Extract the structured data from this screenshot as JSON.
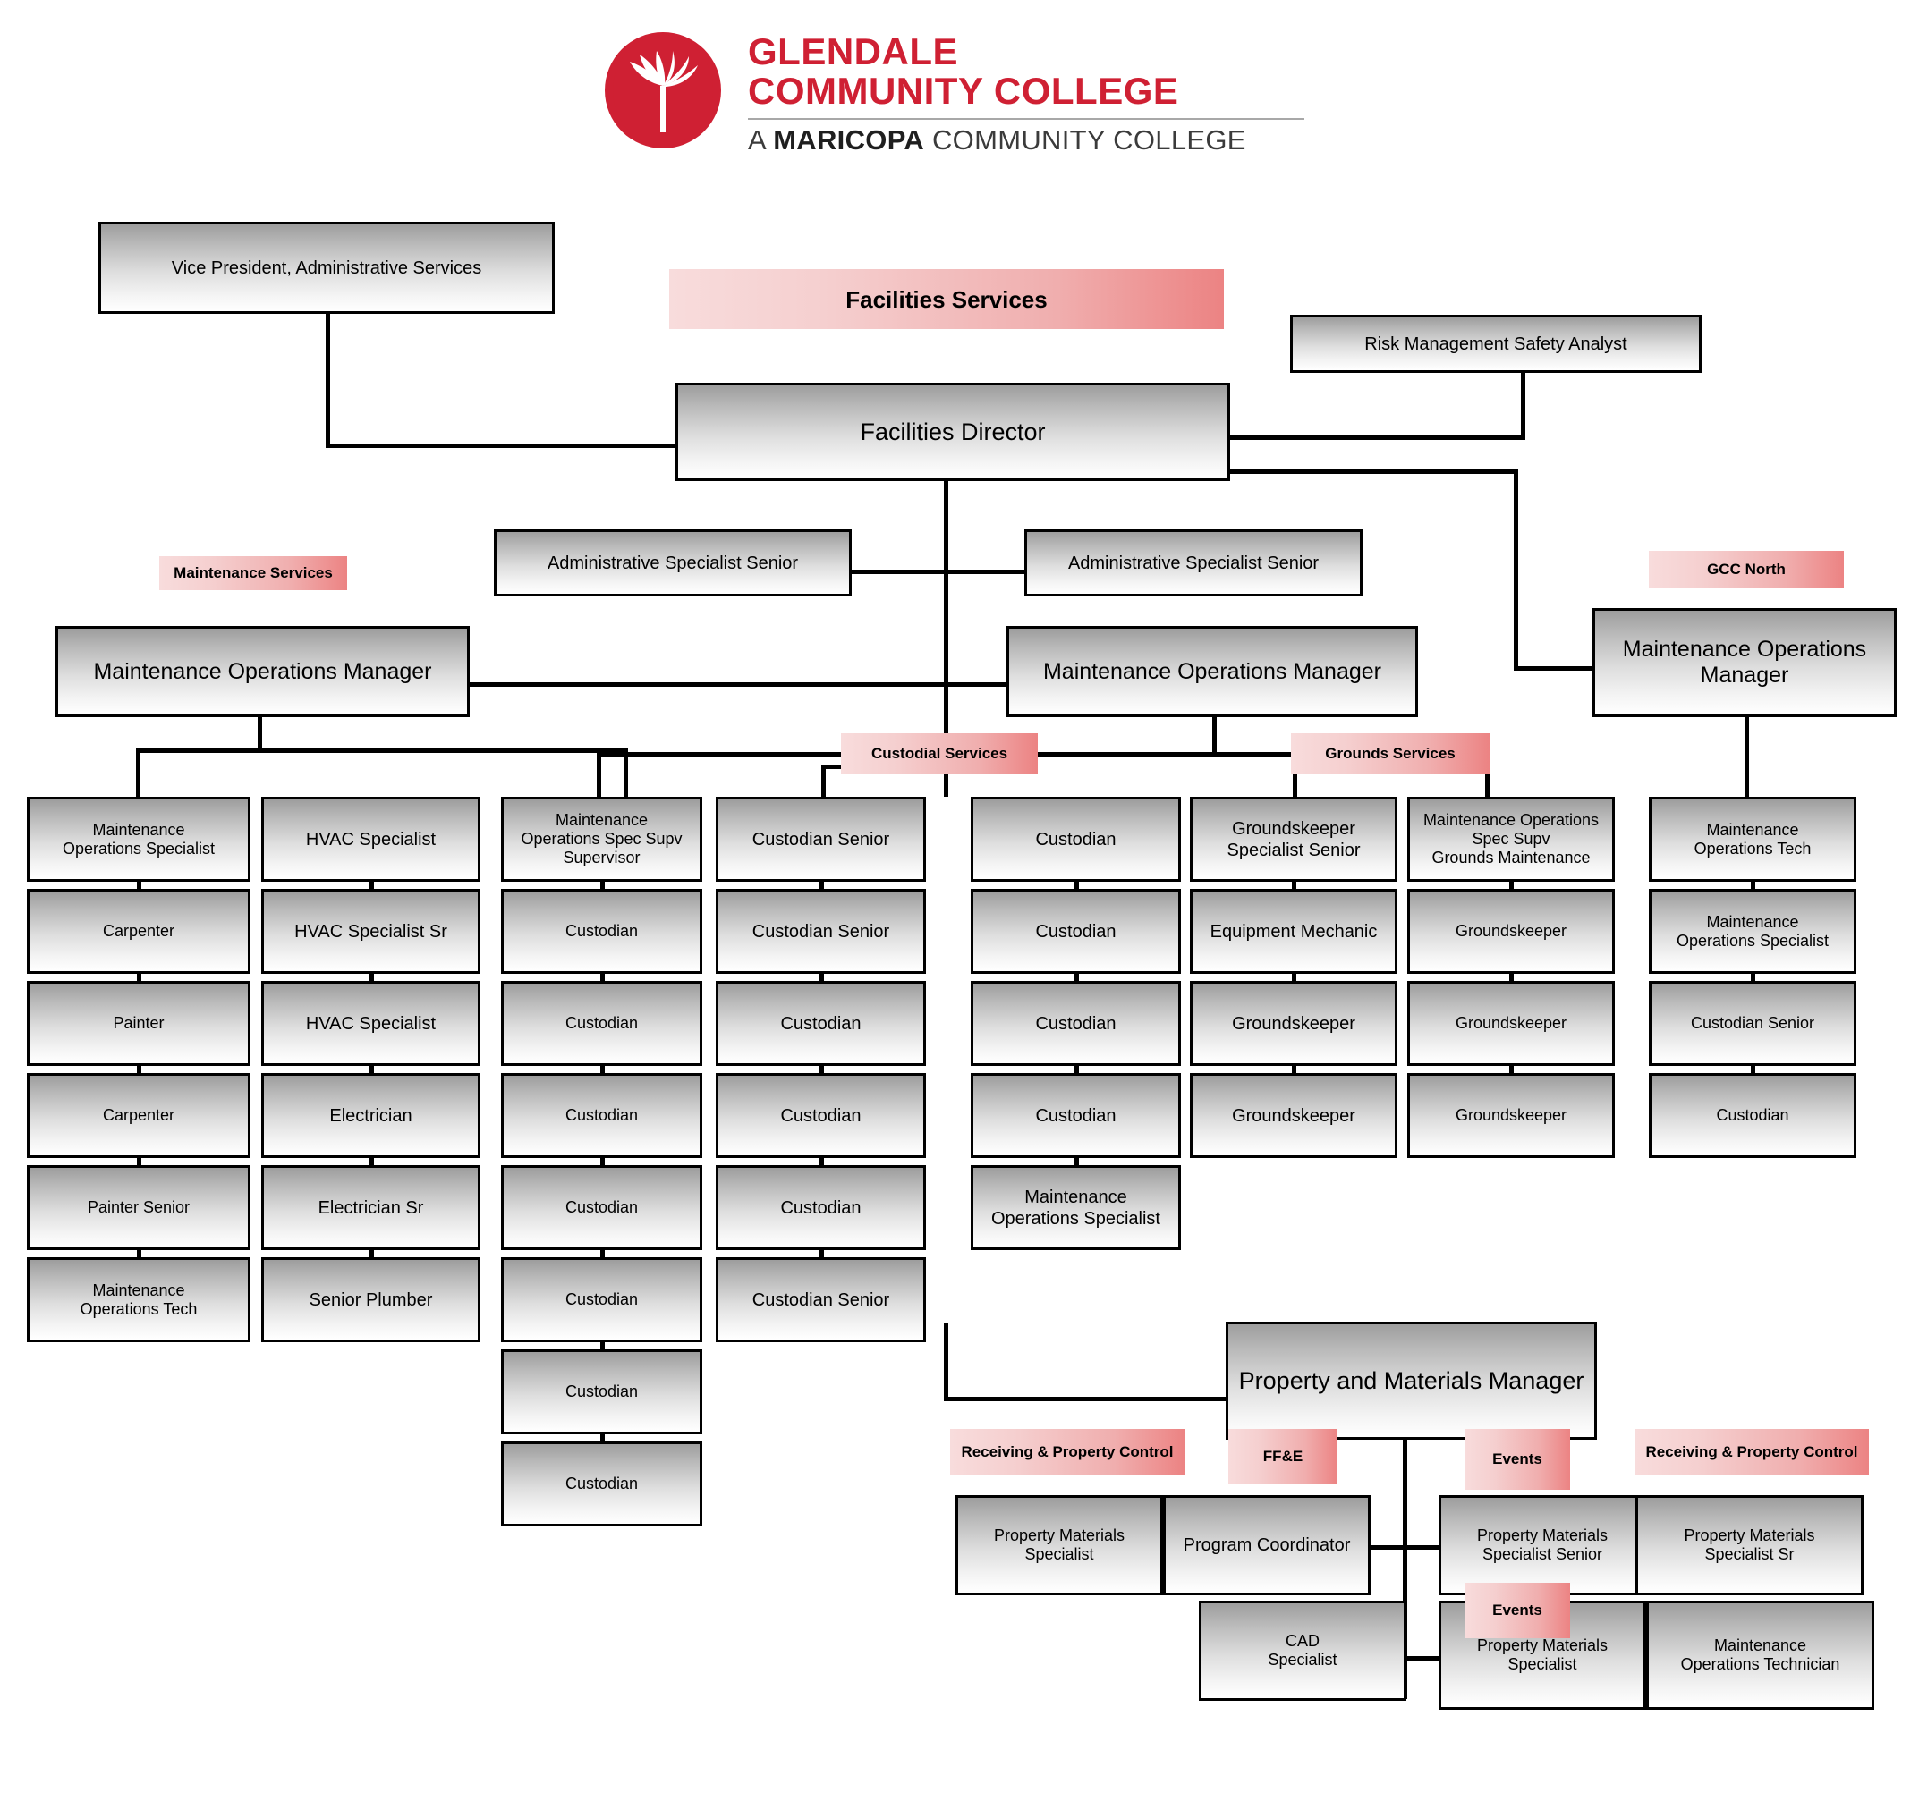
{
  "logo": {
    "line1": "GLENDALE",
    "line2": "COMMUNITY COLLEGE",
    "sub_prefix": "A ",
    "sub_bold": "MARICOPA",
    "sub_suffix": " COMMUNITY COLLEGE",
    "brand_color": "#cf2033"
  },
  "chart_title": "Facilities Services",
  "banners": {
    "facilities_services": "Facilities Services",
    "maintenance_services": "Maintenance Services",
    "custodial_services": "Custodial Services",
    "grounds_services": "Grounds Services",
    "gcc_north": "GCC North",
    "receiving_property_control_left": "Receiving & Property Control",
    "ffe": "FF&E",
    "events_top": "Events",
    "receiving_property_control_right": "Receiving & Property Control",
    "events_bottom": "Events"
  },
  "executive": {
    "vp": "Vice President, Administrative Services",
    "director": "Facilities Director",
    "risk_analyst": "Risk Management Safety Analyst",
    "admin_specialist_left": "Administrative Specialist Senior",
    "admin_specialist_right": "Administrative Specialist Senior"
  },
  "managers": {
    "maintenance_ops_manager_left": "Maintenance Operations Manager",
    "maintenance_ops_manager_center": "Maintenance Operations Manager",
    "maintenance_ops_manager_north": "Maintenance Operations\nManager",
    "property_materials_manager": "Property and Materials Manager"
  },
  "maintenance_col1": [
    "Maintenance\nOperations Specialist",
    "Carpenter",
    "Painter",
    "Carpenter",
    "Painter Senior",
    "Maintenance\nOperations Tech"
  ],
  "maintenance_col2": [
    "HVAC Specialist",
    "HVAC Specialist Sr",
    "HVAC Specialist",
    "Electrician",
    "Electrician Sr",
    "Senior Plumber"
  ],
  "custodial_col1": [
    "Maintenance\nOperations Spec Supv\nSupervisor",
    "Custodian",
    "Custodian",
    "Custodian",
    "Custodian",
    "Custodian",
    "Custodian",
    "Custodian"
  ],
  "custodial_col2": [
    "Custodian Senior",
    "Custodian Senior",
    "Custodian",
    "Custodian",
    "Custodian",
    "Custodian Senior"
  ],
  "custodial_col3": [
    "Custodian",
    "Custodian",
    "Custodian",
    "Custodian",
    "Maintenance\nOperations Specialist"
  ],
  "grounds_col1": [
    "Groundskeeper\nSpecialist Senior",
    "Equipment Mechanic",
    "Groundskeeper",
    "Groundskeeper"
  ],
  "grounds_col2": [
    "Maintenance Operations\nSpec Supv\nGrounds Maintenance",
    "Groundskeeper",
    "Groundskeeper",
    "Groundskeeper"
  ],
  "north_col": [
    "Maintenance\nOperations Tech",
    "Maintenance\nOperations Specialist",
    "Custodian Senior",
    "Custodian"
  ],
  "property_section": [
    "Property Materials\nSpecialist",
    "Program Coordinator",
    "Property Materials\nSpecialist Senior",
    "Property Materials\nSpecialist Sr",
    "CAD\nSpecialist",
    "Property Materials\nSpecialist",
    "Maintenance\nOperations Technician"
  ],
  "chart_data": {
    "type": "diagram",
    "title": "Facilities Services Organizational Chart",
    "nodes": 63,
    "root": "Vice President, Administrative Services"
  }
}
